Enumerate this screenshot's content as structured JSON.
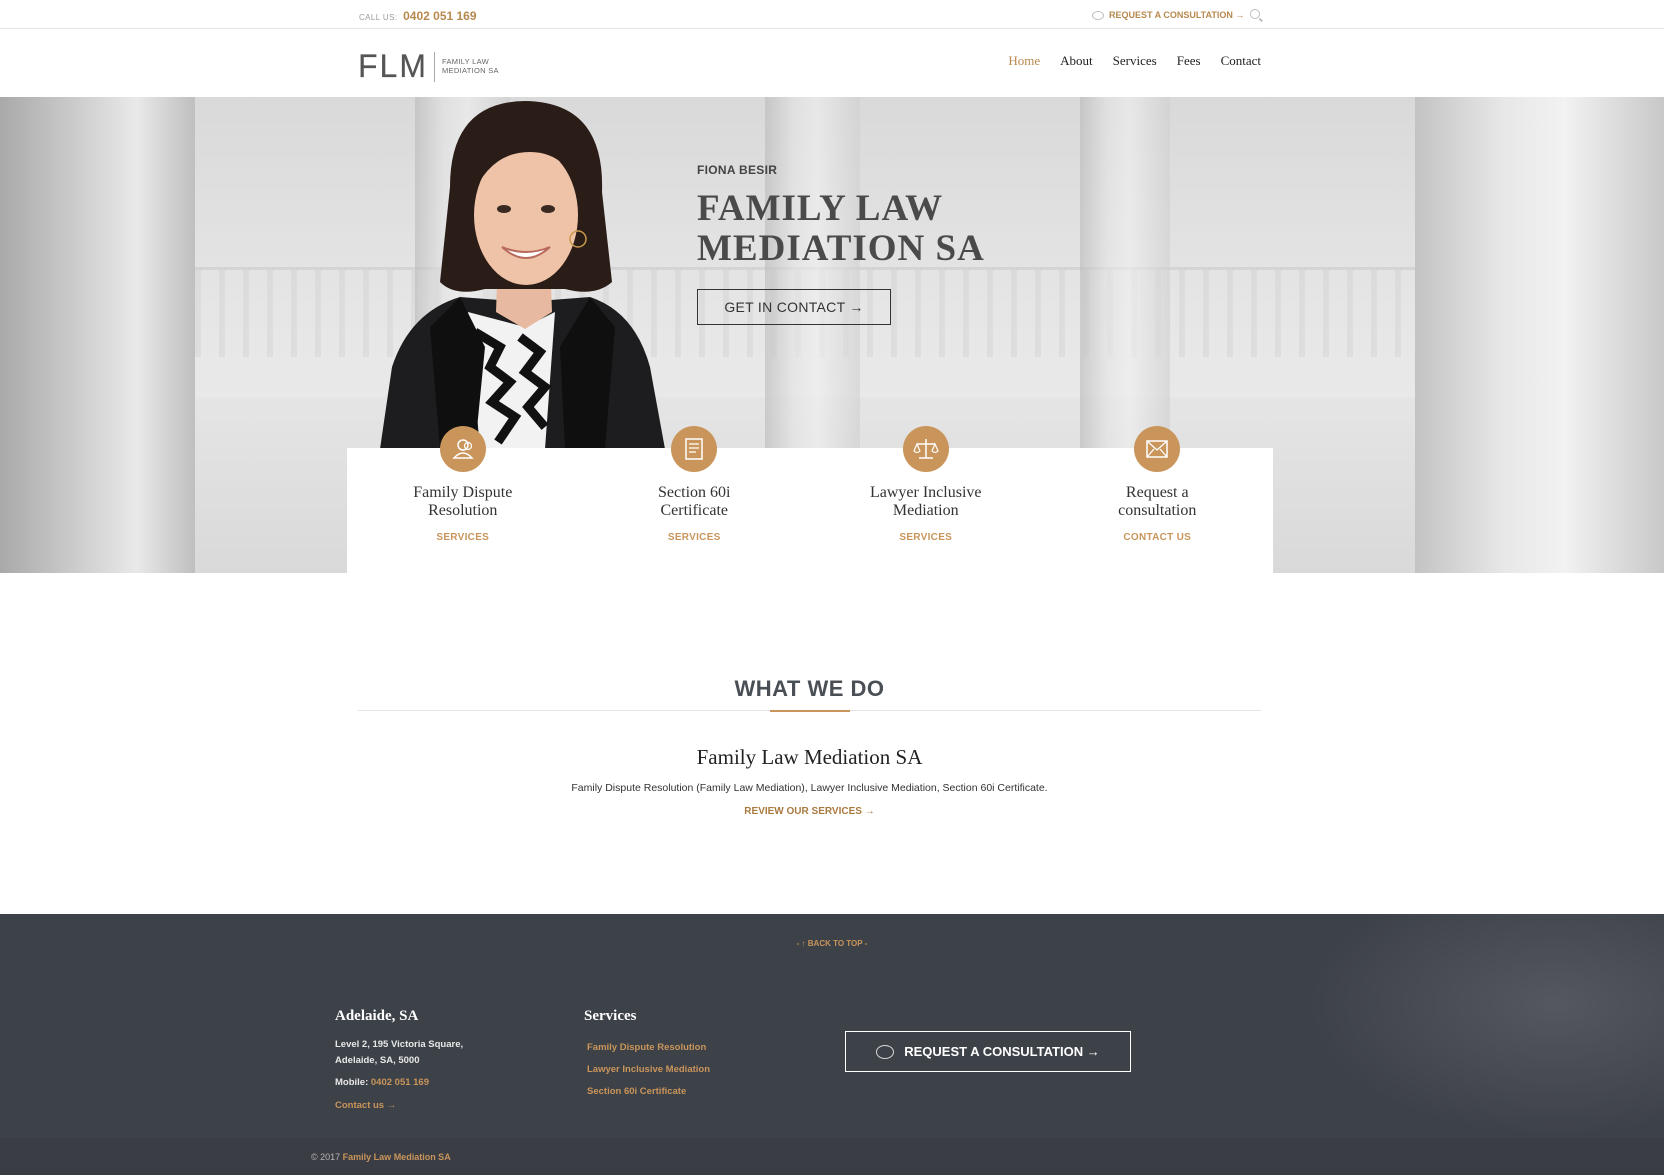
{
  "topbar": {
    "call_label": "CALL US:",
    "phone": "0402 051 169",
    "consult_link": "REQUEST A CONSULTATION →"
  },
  "header": {
    "logo_mark": "FLM",
    "logo_text": "FAMILY LAW MEDIATION SA",
    "nav": [
      "Home",
      "About",
      "Services",
      "Fees",
      "Contact"
    ],
    "active_nav": "Home"
  },
  "hero": {
    "name": "FIONA BESIR",
    "title_line1": "FAMILY LAW",
    "title_line2": "MEDIATION SA",
    "cta": "GET IN CONTACT →"
  },
  "cards": [
    {
      "icon": "people-icon",
      "title_line1": "Family Dispute",
      "title_line2": "Resolution",
      "link": "SERVICES"
    },
    {
      "icon": "certificate-icon",
      "title_line1": "Section 60i",
      "title_line2": "Certificate",
      "link": "SERVICES"
    },
    {
      "icon": "scales-icon",
      "title_line1": "Lawyer Inclusive",
      "title_line2": "Mediation",
      "link": "SERVICES"
    },
    {
      "icon": "envelope-icon",
      "title_line1": "Request a",
      "title_line2": "consultation",
      "link": "CONTACT US"
    }
  ],
  "what_we_do": {
    "heading": "WHAT WE DO",
    "subheading": "Family Law Mediation SA",
    "description": "Family Dispute Resolution (Family Law Mediation), Lawyer Inclusive Mediation, Section 60i Certificate.",
    "review_link": "REVIEW OUR SERVICES →"
  },
  "footer": {
    "back_to_top": "- ↑ BACK TO TOP -",
    "location_heading": "Adelaide, SA",
    "address_line1": "Level 2, 195 Victoria Square,",
    "address_line2": "Adelaide, SA, 5000",
    "mobile_label": "Mobile:",
    "mobile": "0402 051 169",
    "contact_link": "Contact us →",
    "services_heading": "Services",
    "services_links": [
      "Family Dispute Resolution",
      "Lawyer Inclusive Mediation",
      "Section 60i Certificate"
    ],
    "consult_button": "REQUEST A CONSULTATION →",
    "copyright": "© 2017",
    "copyright_name": "Family Law Mediation SA"
  },
  "colors": {
    "accent": "#c9955b",
    "footer_bg": "#3d4148",
    "text_dark": "#4a4a4a"
  }
}
